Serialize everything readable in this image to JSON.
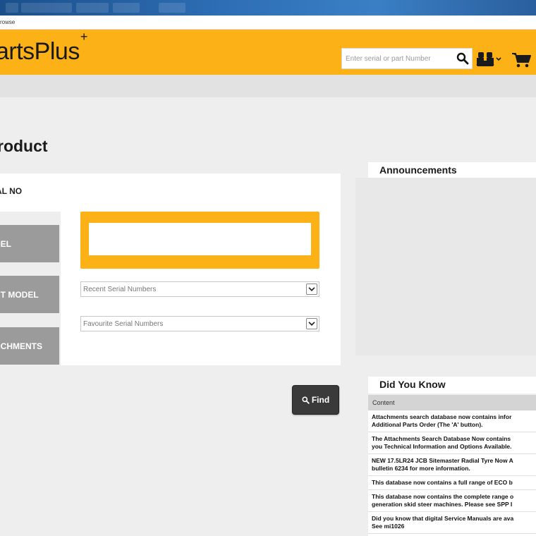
{
  "taskbar": {
    "items": [
      "",
      "",
      "",
      "",
      ""
    ]
  },
  "address": {
    "text": "rowse"
  },
  "header": {
    "logo": "artsPlus",
    "logo_mark": "+",
    "search_placeholder": "Enter serial or part Number",
    "accent_color": "#fcb117"
  },
  "page": {
    "title": "roduct"
  },
  "panel": {
    "serial_label": "AL NO",
    "tabs": [
      {
        "label": "DEL"
      },
      {
        "label": "NT MODEL"
      },
      {
        "label": "ACHMENTS"
      }
    ],
    "recent_select": "Recent Serial Numbers",
    "favourite_select": "Favourite Serial Numbers",
    "find_label": "Find"
  },
  "announcements": {
    "title": "Announcements"
  },
  "did_you_know": {
    "title": "Did You Know",
    "column": "Content",
    "rows": [
      "Attachments search database now contains infor\nAdditional Parts Order (The 'A' button).",
      "The Attachments Search Database Now contains\nyou Technical Information and Options Available.",
      "NEW 17.5LR24 JCB Sitemaster Radial Tyre Now A\nbulletin 6234 for more information.",
      "This database now contains a full range of ECO b",
      "This database now contains the complete range o\ngeneration skid steer machines. Please see SPP I",
      "Did you know that digital Service Manuals are ava\nSee mi1026"
    ]
  }
}
